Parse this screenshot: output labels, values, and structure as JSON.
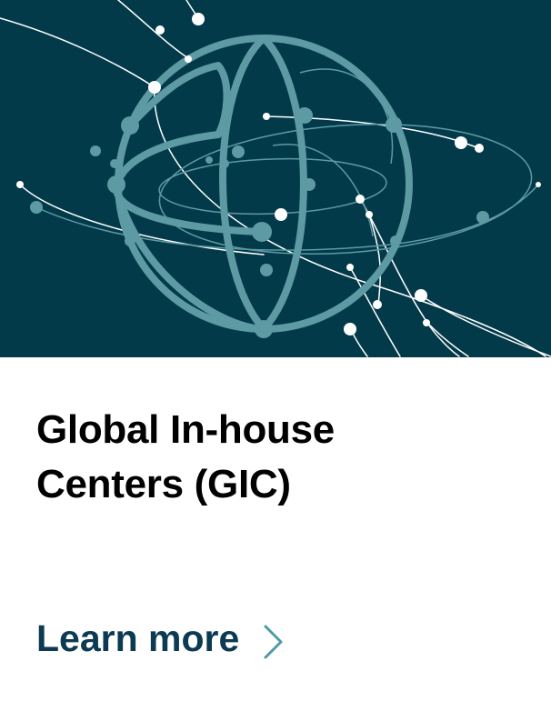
{
  "card": {
    "title_line1": "Global In-house",
    "title_line2": "Centers (GIC)",
    "cta_label": "Learn more",
    "cta_icon": "chevron-right-icon"
  },
  "hero": {
    "illustration": "globe-network-icon"
  },
  "colors": {
    "hero_background": "#033a4a",
    "globe_stroke": "#5d9aa3",
    "node_white": "#ffffff",
    "cta_text": "#0b3a52",
    "chevron": "#4e9aa4",
    "title_text": "#000000"
  }
}
